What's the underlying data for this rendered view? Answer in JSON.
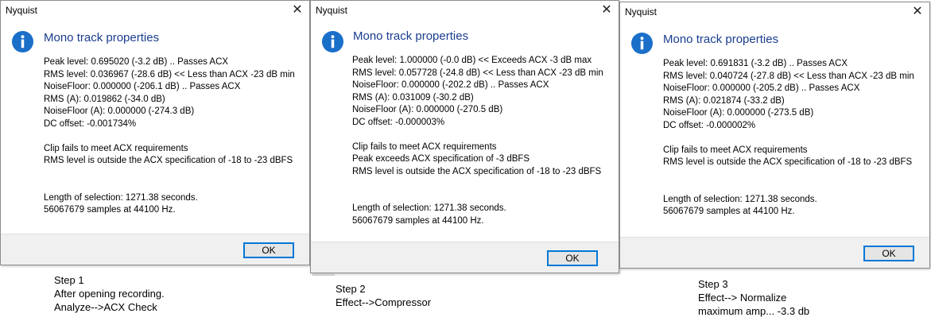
{
  "dialogs": [
    {
      "title": "Nyquist",
      "heading": "Mono track properties",
      "lines": [
        "Peak level: 0.695020 (-3.2 dB)  .. Passes ACX",
        "RMS level: 0.036967 (-28.6 dB)  << Less than ACX -23 dB min",
        "NoiseFloor: 0.000000 (-206.1 dB)  .. Passes ACX",
        "RMS (A): 0.019862 (-34.0 dB)",
        "NoiseFloor (A): 0.000000 (-274.3 dB)",
        "DC offset: -0.001734%"
      ],
      "results": [
        "Clip fails to meet ACX requirements",
        "RMS level is outside the ACX specification of -18 to -23 dBFS"
      ],
      "selection": [
        "Length of selection: 1271.38 seconds.",
        "56067679 samples at 44100 Hz."
      ],
      "ok_label": "OK"
    },
    {
      "title": "Nyquist",
      "heading": "Mono track properties",
      "lines": [
        "Peak level: 1.000000 (-0.0 dB)  << Exceeds ACX -3 dB max",
        "RMS level: 0.057728 (-24.8 dB)  << Less than ACX -23 dB min",
        "NoiseFloor: 0.000000 (-202.2 dB)  .. Passes ACX",
        "RMS (A): 0.031009 (-30.2 dB)",
        "NoiseFloor (A): 0.000000 (-270.5 dB)",
        "DC offset: -0.000003%"
      ],
      "results": [
        "Clip fails to meet ACX requirements",
        "Peak exceeds ACX specification of -3 dBFS",
        "RMS level is outside the ACX specification of -18 to -23 dBFS"
      ],
      "selection": [
        "Length of selection: 1271.38 seconds.",
        "56067679 samples at 44100 Hz."
      ],
      "ok_label": "OK"
    },
    {
      "title": "Nyquist",
      "heading": "Mono track properties",
      "lines": [
        "Peak level: 0.691831 (-3.2 dB)  .. Passes ACX",
        "RMS level: 0.040724 (-27.8 dB)  << Less than ACX -23 dB min",
        "NoiseFloor: 0.000000 (-205.2 dB)  .. Passes ACX",
        "RMS (A): 0.021874 (-33.2 dB)",
        "NoiseFloor (A): 0.000000 (-273.5 dB)",
        "DC offset: -0.000002%"
      ],
      "results": [
        "Clip fails to meet ACX requirements",
        "RMS level is outside the ACX specification of -18 to -23 dBFS"
      ],
      "selection": [
        "Length of selection: 1271.38 seconds.",
        "56067679 samples at 44100 Hz."
      ],
      "ok_label": "OK"
    }
  ],
  "steps": [
    {
      "lines": [
        "Step 1",
        "After opening recording.",
        "Analyze-->ACX Check"
      ]
    },
    {
      "lines": [
        "Step 2",
        "Effect-->Compressor"
      ]
    },
    {
      "lines": [
        "Step 3",
        "Effect--> Normalize",
        "maximum amp... -3.3 db"
      ]
    }
  ],
  "icons": {
    "info": "info-icon",
    "close": "close-icon"
  },
  "colors": {
    "heading": "#1a3d8f",
    "info_icon": "#1a6fc9",
    "ok_border": "#0078d7",
    "footer": "#f0f0f0"
  }
}
